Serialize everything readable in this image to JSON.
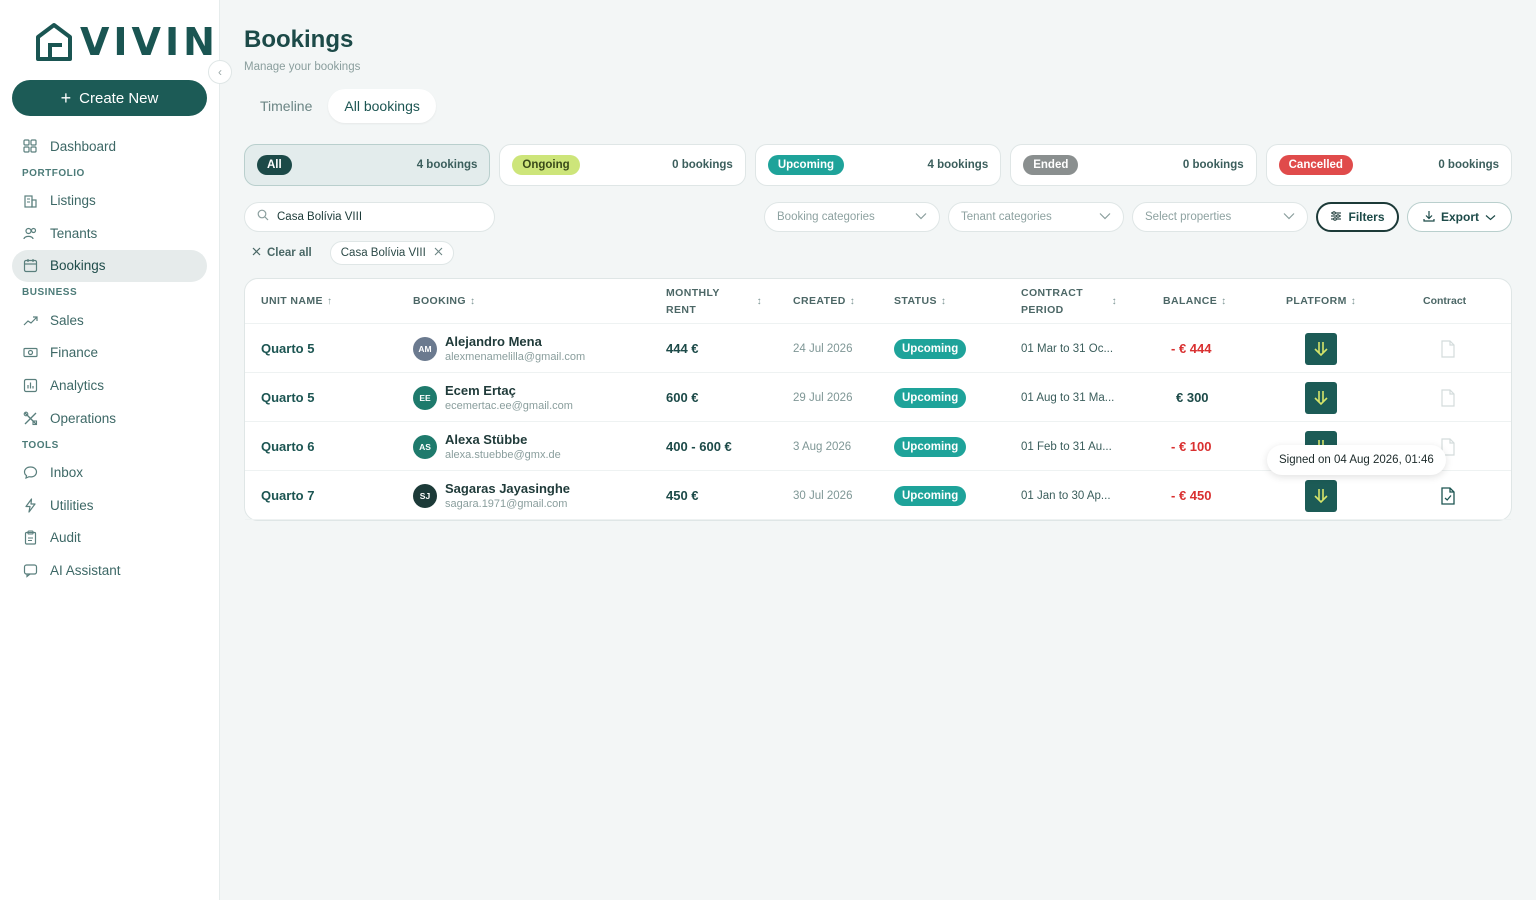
{
  "app": {
    "logo_text": "VIVIN"
  },
  "sidebar": {
    "create_label": "Create New",
    "dashboard": "Dashboard",
    "sections": {
      "portfolio": "PORTFOLIO",
      "business": "BUSINESS",
      "tools": "TOOLS"
    },
    "items": {
      "listings": "Listings",
      "tenants": "Tenants",
      "bookings": "Bookings",
      "sales": "Sales",
      "finance": "Finance",
      "analytics": "Analytics",
      "operations": "Operations",
      "inbox": "Inbox",
      "utilities": "Utilities",
      "audit": "Audit",
      "ai_assistant": "AI Assistant"
    }
  },
  "page": {
    "title": "Bookings",
    "subtitle": "Manage your bookings",
    "tabs": [
      "Timeline",
      "All bookings"
    ],
    "active_tab": "All bookings"
  },
  "status_cards": [
    {
      "label": "All",
      "count": "4 bookings",
      "bg": "#1c4a48",
      "fg": "#ffffff"
    },
    {
      "label": "Ongoing",
      "count": "0 bookings",
      "bg": "#cde57a",
      "fg": "#3a4a1a"
    },
    {
      "label": "Upcoming",
      "count": "4 bookings",
      "bg": "#1ea39a",
      "fg": "#ffffff"
    },
    {
      "label": "Ended",
      "count": "0 bookings",
      "bg": "#8a8f8f",
      "fg": "#ffffff"
    },
    {
      "label": "Cancelled",
      "count": "0 bookings",
      "bg": "#e04b4b",
      "fg": "#ffffff"
    }
  ],
  "toolbar": {
    "search_value": "Casa Bolívia VIII",
    "booking_categories": "Booking categories",
    "tenant_categories": "Tenant categories",
    "select_properties": "Select properties",
    "filters": "Filters",
    "export": "Export"
  },
  "chips": {
    "clear_all": "Clear all",
    "active_filter": "Casa Bolívia VIII"
  },
  "table": {
    "headers": {
      "unit": "UNIT NAME",
      "booking": "BOOKING",
      "rent_line1": "MONTHLY",
      "rent_line2": "RENT",
      "created": "CREATED",
      "status": "STATUS",
      "period_line1": "CONTRACT",
      "period_line2": "PERIOD",
      "balance": "BALANCE",
      "platform": "PLATFORM",
      "contract": "Contract"
    },
    "rows": [
      {
        "unit": "Quarto 5",
        "initials": "AM",
        "avatar_color": "#6b7a8f",
        "name": "Alejandro Mena",
        "email": "alexmenamelilla@gmail.com",
        "rent": "444 €",
        "created": "24 Jul 2026",
        "status": "Upcoming",
        "period": "01 Mar to 31 Oc...",
        "balance": "- € 444",
        "balance_color": "#d93030",
        "contract_signed": false
      },
      {
        "unit": "Quarto 5",
        "initials": "EE",
        "avatar_color": "#1e7a6c",
        "name": "Ecem Ertaç",
        "email": "ecemertac.ee@gmail.com",
        "rent": "600 €",
        "created": "29 Jul 2026",
        "status": "Upcoming",
        "period": "01 Aug to 31 Ma...",
        "balance": "€ 300",
        "balance_color": "#1c4a48",
        "contract_signed": false
      },
      {
        "unit": "Quarto 6",
        "initials": "AS",
        "avatar_color": "#1e7a6c",
        "name": "Alexa Stübbe",
        "email": "alexa.stuebbe@gmx.de",
        "rent": "400 - 600 €",
        "created": "3 Aug 2026",
        "status": "Upcoming",
        "period": "01 Feb to 31 Au...",
        "balance": "- € 100",
        "balance_color": "#d93030",
        "contract_signed": false
      },
      {
        "unit": "Quarto 7",
        "initials": "SJ",
        "avatar_color": "#1c3a38",
        "name": "Sagaras Jayasinghe",
        "email": "sagara.1971@gmail.com",
        "rent": "450 €",
        "created": "30 Jul 2026",
        "status": "Upcoming",
        "period": "01 Jan to 30 Ap...",
        "balance": "- € 450",
        "balance_color": "#d93030",
        "contract_signed": true
      }
    ]
  },
  "tooltip": {
    "text": "Signed on 04 Aug 2026, 01:46"
  }
}
